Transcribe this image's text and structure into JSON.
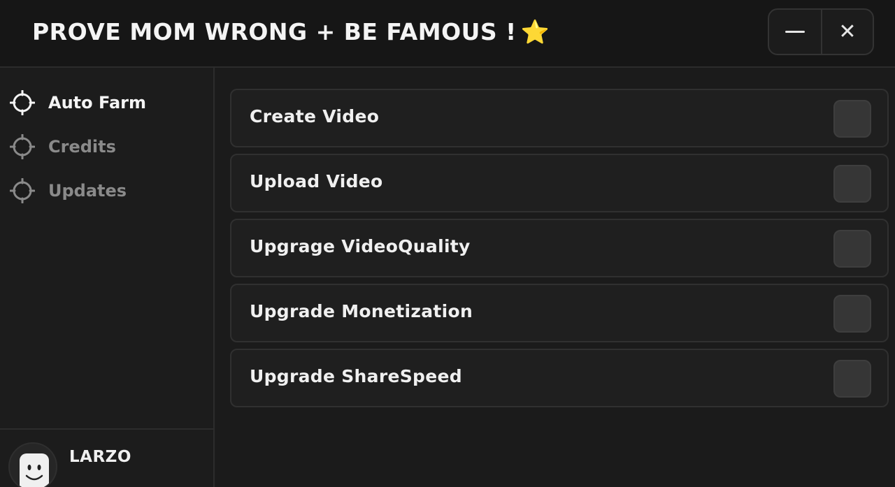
{
  "window": {
    "title": "PROVE MOM WRONG + BE FAMOUS !",
    "title_emoji": "⭐",
    "minimize_icon": "minimize-icon",
    "close_icon": "close-icon",
    "close_glyph": "✕"
  },
  "sidebar": {
    "items": [
      {
        "label": "Auto Farm",
        "icon": "crosshair-icon",
        "active": true
      },
      {
        "label": "Credits",
        "icon": "crosshair-icon",
        "active": false
      },
      {
        "label": "Updates",
        "icon": "crosshair-icon",
        "active": false
      }
    ],
    "user": {
      "name": "LARZO",
      "avatar_icon": "avatar-face-icon"
    }
  },
  "main": {
    "toggles": [
      {
        "label": "Create Video",
        "enabled": false
      },
      {
        "label": "Upload Video",
        "enabled": false
      },
      {
        "label": "Upgrage VideoQuality",
        "enabled": false
      },
      {
        "label": "Upgrade Monetization",
        "enabled": false
      },
      {
        "label": "Upgrade ShareSpeed",
        "enabled": false
      }
    ]
  },
  "colors": {
    "background": "#1b1b1b",
    "accent_star": "#f5b321",
    "active_text": "#f4f4f4",
    "inactive_text": "#8a8a8a",
    "toggle_off": "#363636"
  }
}
